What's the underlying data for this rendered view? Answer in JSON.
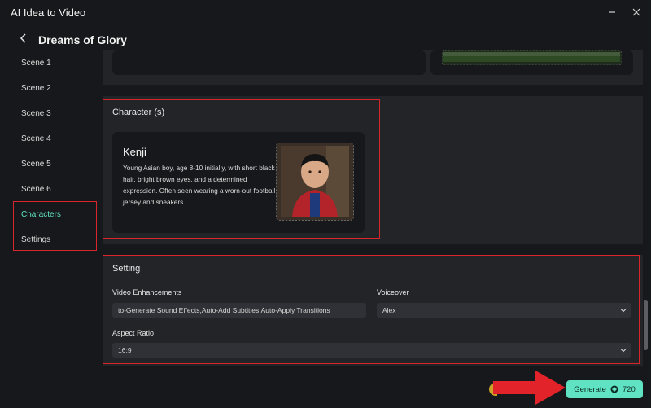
{
  "window": {
    "title": "AI Idea to Video"
  },
  "header": {
    "title": "Dreams of Glory"
  },
  "sidebar": {
    "items": [
      {
        "label": "Scene 1"
      },
      {
        "label": "Scene 2"
      },
      {
        "label": "Scene 3"
      },
      {
        "label": "Scene 4"
      },
      {
        "label": "Scene 5"
      },
      {
        "label": "Scene 6"
      },
      {
        "label": "Characters"
      },
      {
        "label": "Settings"
      }
    ],
    "active": "Characters"
  },
  "characters": {
    "section_title": "Character (s)",
    "items": [
      {
        "name": "Kenji",
        "description": "Young Asian boy, age 8-10 initially, with short black hair, bright brown eyes, and a determined expression. Often seen wearing a worn-out football jersey and sneakers."
      }
    ]
  },
  "setting": {
    "section_title": "Setting",
    "video_enhancements": {
      "label": "Video Enhancements",
      "value": "to-Generate Sound Effects,Auto-Add Subtitles,Auto-Apply Transitions"
    },
    "voiceover": {
      "label": "Voiceover",
      "value": "Alex"
    },
    "aspect_ratio": {
      "label": "Aspect Ratio",
      "value": "16:9"
    }
  },
  "footer": {
    "generate_label": "Generate",
    "credits": "720"
  },
  "colors": {
    "accent": "#5fe3c2",
    "highlight": "#d9262c",
    "arrow": "#e3232a",
    "background": "#17181b",
    "panel": "#222428"
  }
}
